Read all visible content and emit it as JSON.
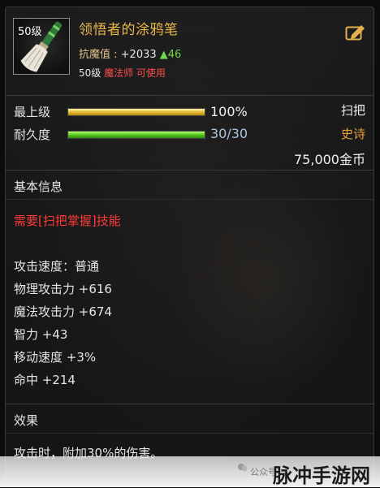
{
  "item": {
    "level_badge": "50级",
    "name": "领悟者的涂鸦笔",
    "attack_label": "抗魔值 :",
    "attack_value": "+2033",
    "attack_up": "▲46",
    "req_level": "50级",
    "req_class": "魔法师 可使用",
    "icon": "brush-broom-icon",
    "edit_icon": "edit-icon"
  },
  "status": {
    "upgrade_label": "最上级",
    "upgrade_percent": "100%",
    "upgrade_fill": 1.0,
    "durability_label": "耐久度",
    "durability_text": "30/30",
    "durability_fill": 1.0,
    "item_type": "扫把",
    "rarity": "史诗",
    "price": "75,000金币"
  },
  "basic_info": {
    "title": "基本信息",
    "requirement": "需要[扫把掌握]技能",
    "stats": [
      "攻击速度：普通",
      "物理攻击力 +616",
      "魔法攻击力 +674",
      "智力 +43",
      "移动速度 +3%",
      "命中 +214"
    ]
  },
  "effect": {
    "title": "效果",
    "text": "攻击时，附加30%的伤害。"
  },
  "watermark": {
    "small": "公众号·",
    "big": "脉冲手游网"
  },
  "colors": {
    "name_gold": "#e8b84a",
    "rarity_orange": "#e8a23a",
    "requirement_red": "#ff3b3b",
    "durability_blue": "#a9c4e0",
    "stat_up_green": "#6fd84c"
  }
}
